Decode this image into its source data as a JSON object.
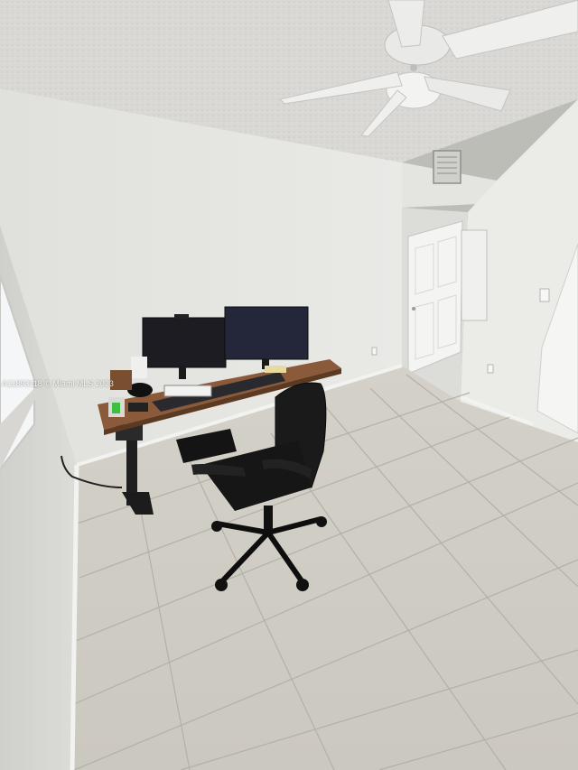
{
  "photo": {
    "watermark": "A11893118 © Miami MLS 2023"
  },
  "colors": {
    "wall": "#e6e6e3",
    "ceiling": "#d9d8d4",
    "floor_tile": "#d8d5cc",
    "desk_top": "#8a5a3a",
    "monitor": "#1c1c22",
    "chair": "#1a1a1a",
    "door": "#f4f4f2"
  }
}
